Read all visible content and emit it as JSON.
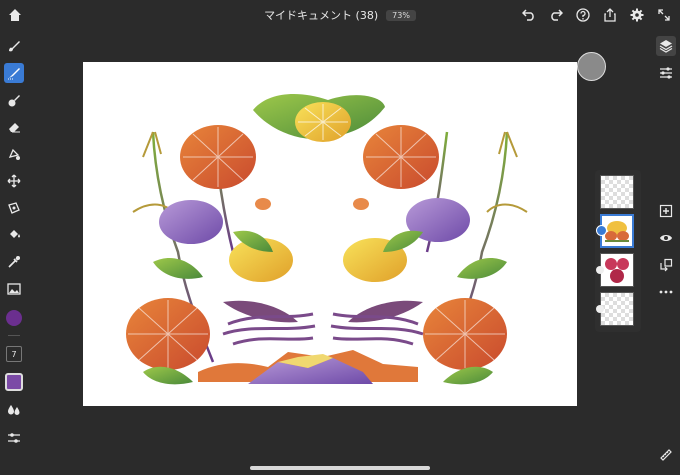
{
  "document": {
    "title": "マイドキュメント (38)",
    "zoom": "73%"
  },
  "toolbar": {
    "size_badge": "7"
  },
  "colors": {
    "primary": "#6b2f8f",
    "swatch": "#7b4aa6",
    "active_tool": "#3a7bd5"
  },
  "layers": [
    "empty",
    "flowers",
    "red-flowers",
    "empty-small"
  ],
  "icons": {
    "top_left": [
      "home-icon"
    ],
    "top_right": [
      "undo-icon",
      "redo-icon",
      "help-icon",
      "share-icon",
      "settings-icon",
      "fullscreen-icon"
    ],
    "left_tools": [
      "brush-icon",
      "pixel-brush-icon",
      "fill-brush-icon",
      "eraser-icon",
      "lasso-icon",
      "move-icon",
      "transform-icon",
      "paint-bucket-icon",
      "eyedropper-icon",
      "image-icon"
    ],
    "right_tools": [
      "layers-icon",
      "adjust-icon",
      "add-layer-icon",
      "visibility-icon",
      "merge-icon",
      "more-icon",
      "ruler-icon"
    ]
  }
}
